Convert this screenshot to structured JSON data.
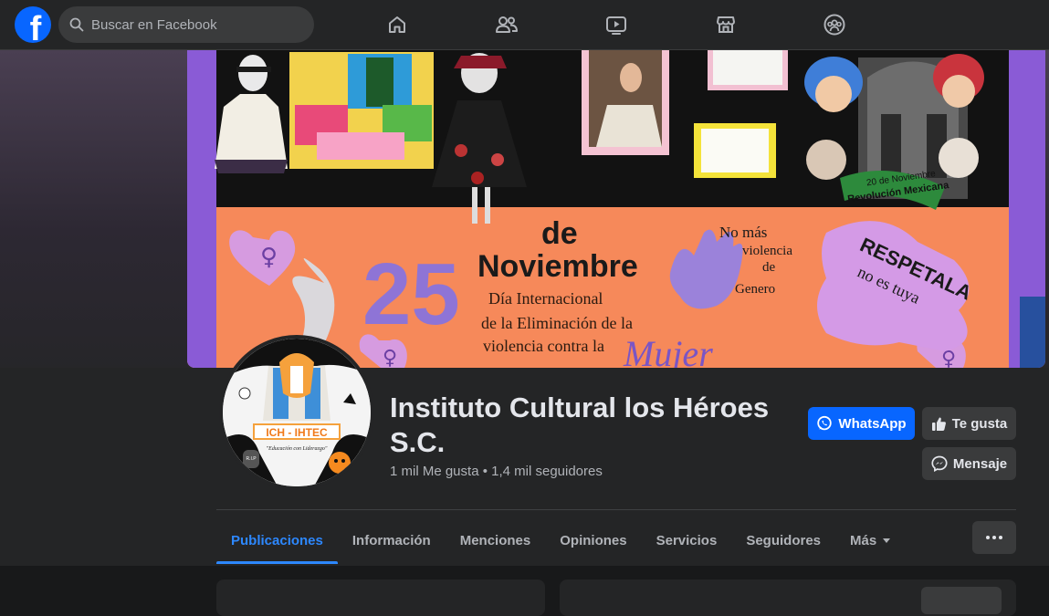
{
  "topbar": {
    "search_placeholder": "Buscar en Facebook",
    "nav_icons": [
      "home-icon",
      "friends-icon",
      "video-icon",
      "marketplace-icon",
      "groups-icon"
    ]
  },
  "cover": {
    "text_de": "de",
    "text_noviembre": "Noviembre",
    "text_25": "25",
    "text_dia_line1": "Día Internacional",
    "text_dia_line2": "de la Eliminación de la",
    "text_dia_line3": "violencia contra la",
    "text_mujer": "Mujer",
    "text_nomas_1": "No más",
    "text_nomas_2": "violencia",
    "text_nomas_3": "de",
    "text_nomas_4": "Genero",
    "text_respetala_1": "RESPETALA",
    "text_respetala_2": "no es tuya",
    "text_revolucion_1": "20 de Noviembre",
    "text_revolucion_2": "Revolución Mexicana"
  },
  "avatar": {
    "logo_text": "ICH - IHTEC",
    "motto": "\"Educación con Liderazgo\"",
    "tomb_text": "R.I.P"
  },
  "page": {
    "name": "Instituto Cultural los Héroes S.C.",
    "stats": "1 mil Me gusta • 1,4 mil seguidores"
  },
  "actions": {
    "whatsapp": "WhatsApp",
    "like": "Te gusta",
    "message": "Mensaje"
  },
  "tabs": [
    {
      "label": "Publicaciones"
    },
    {
      "label": "Información"
    },
    {
      "label": "Menciones"
    },
    {
      "label": "Opiniones"
    },
    {
      "label": "Servicios"
    },
    {
      "label": "Seguidores"
    },
    {
      "label": "Más"
    }
  ],
  "colors": {
    "accent": "#0866ff",
    "active_tab": "#2d88ff",
    "background": "#18191a",
    "surface": "#242526"
  }
}
